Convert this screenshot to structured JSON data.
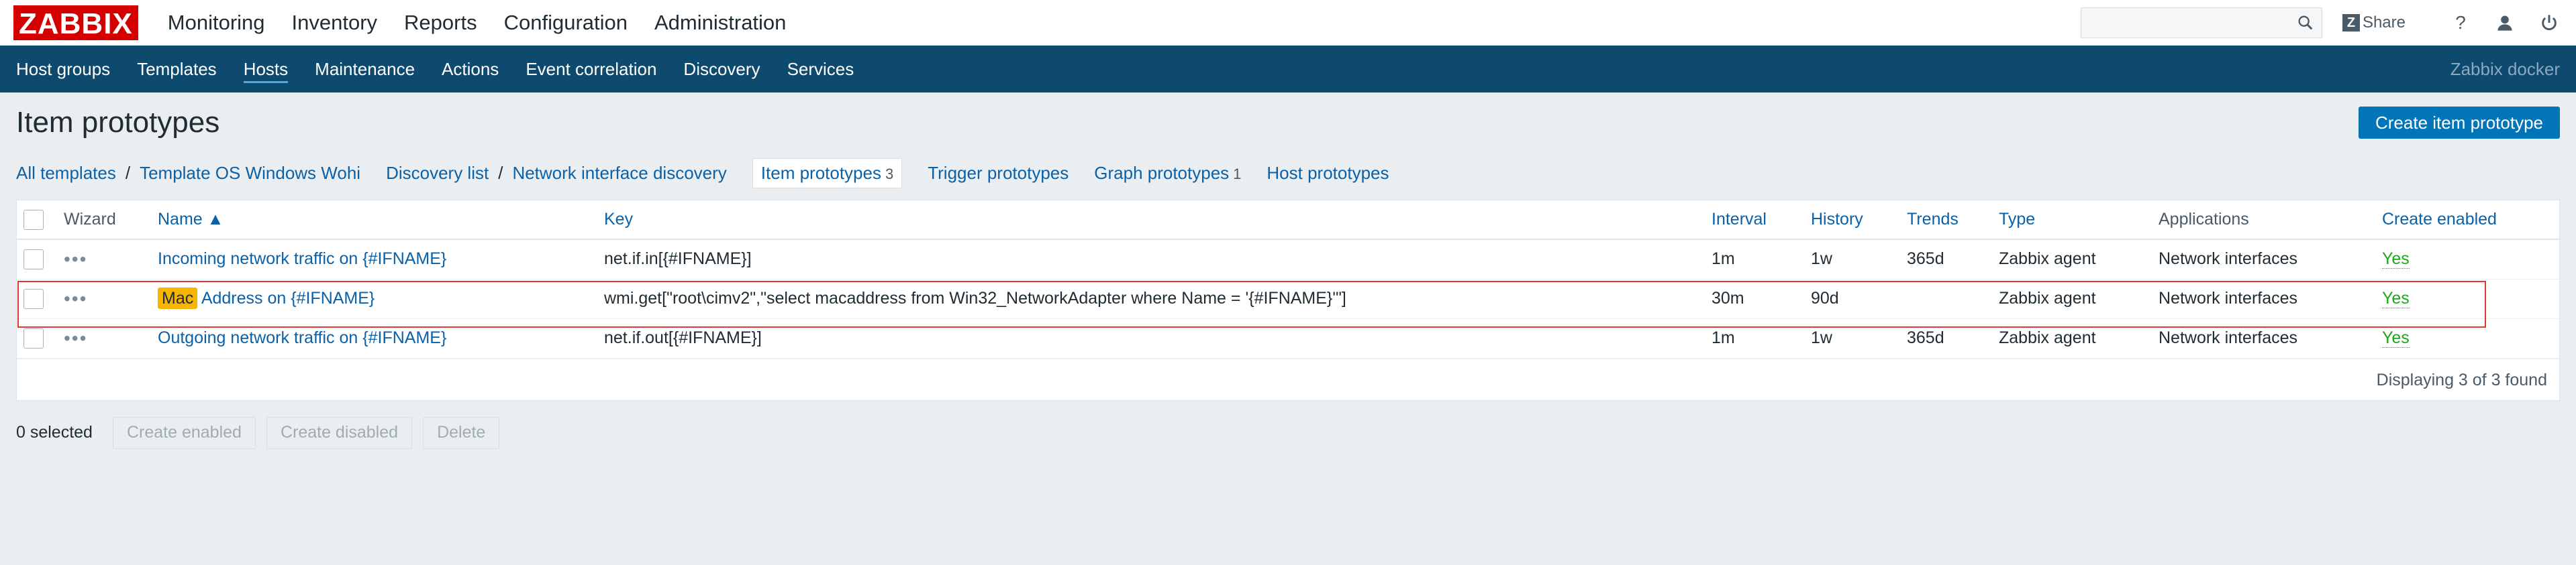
{
  "app": {
    "logo_text": "ZABBIX",
    "main_menu": [
      "Monitoring",
      "Inventory",
      "Reports",
      "Configuration",
      "Administration"
    ],
    "share_label": "Share",
    "search_placeholder": "",
    "server_name": "Zabbix docker"
  },
  "sub_nav": [
    "Host groups",
    "Templates",
    "Hosts",
    "Maintenance",
    "Actions",
    "Event correlation",
    "Discovery",
    "Services"
  ],
  "header": {
    "title": "Item prototypes",
    "create_button": "Create item prototype"
  },
  "breadcrumbs": {
    "all_templates": "All templates",
    "template": "Template OS Windows Wohi",
    "discovery_list": "Discovery list",
    "discovery_rule": "Network interface discovery",
    "tabs": [
      {
        "label": "Item prototypes",
        "count": "3"
      },
      {
        "label": "Trigger prototypes",
        "count": ""
      },
      {
        "label": "Graph prototypes",
        "count": "1"
      },
      {
        "label": "Host prototypes",
        "count": ""
      }
    ]
  },
  "table": {
    "headers": {
      "wizard": "Wizard",
      "name": "Name ▲",
      "key": "Key",
      "interval": "Interval",
      "history": "History",
      "trends": "Trends",
      "type": "Type",
      "applications": "Applications",
      "create_enabled": "Create enabled"
    },
    "rows": [
      {
        "name_highlight": "",
        "name": "Incoming network traffic on {#IFNAME}",
        "key": "net.if.in[{#IFNAME}]",
        "interval": "1m",
        "history": "1w",
        "trends": "365d",
        "type": "Zabbix agent",
        "applications": "Network interfaces",
        "create_enabled": "Yes"
      },
      {
        "name_highlight": "Mac",
        "name": "Address on {#IFNAME}",
        "key": "wmi.get[\"root\\cimv2\",\"select macaddress from Win32_NetworkAdapter where Name = '{#IFNAME}'\"]",
        "interval": "30m",
        "history": "90d",
        "trends": "",
        "type": "Zabbix agent",
        "applications": "Network interfaces",
        "create_enabled": "Yes"
      },
      {
        "name_highlight": "",
        "name": "Outgoing network traffic on {#IFNAME}",
        "key": "net.if.out[{#IFNAME}]",
        "interval": "1m",
        "history": "1w",
        "trends": "365d",
        "type": "Zabbix agent",
        "applications": "Network interfaces",
        "create_enabled": "Yes"
      }
    ],
    "footer": "Displaying 3 of 3 found"
  },
  "actions": {
    "selected": "0 selected",
    "create_enabled": "Create enabled",
    "create_disabled": "Create disabled",
    "delete": "Delete"
  }
}
